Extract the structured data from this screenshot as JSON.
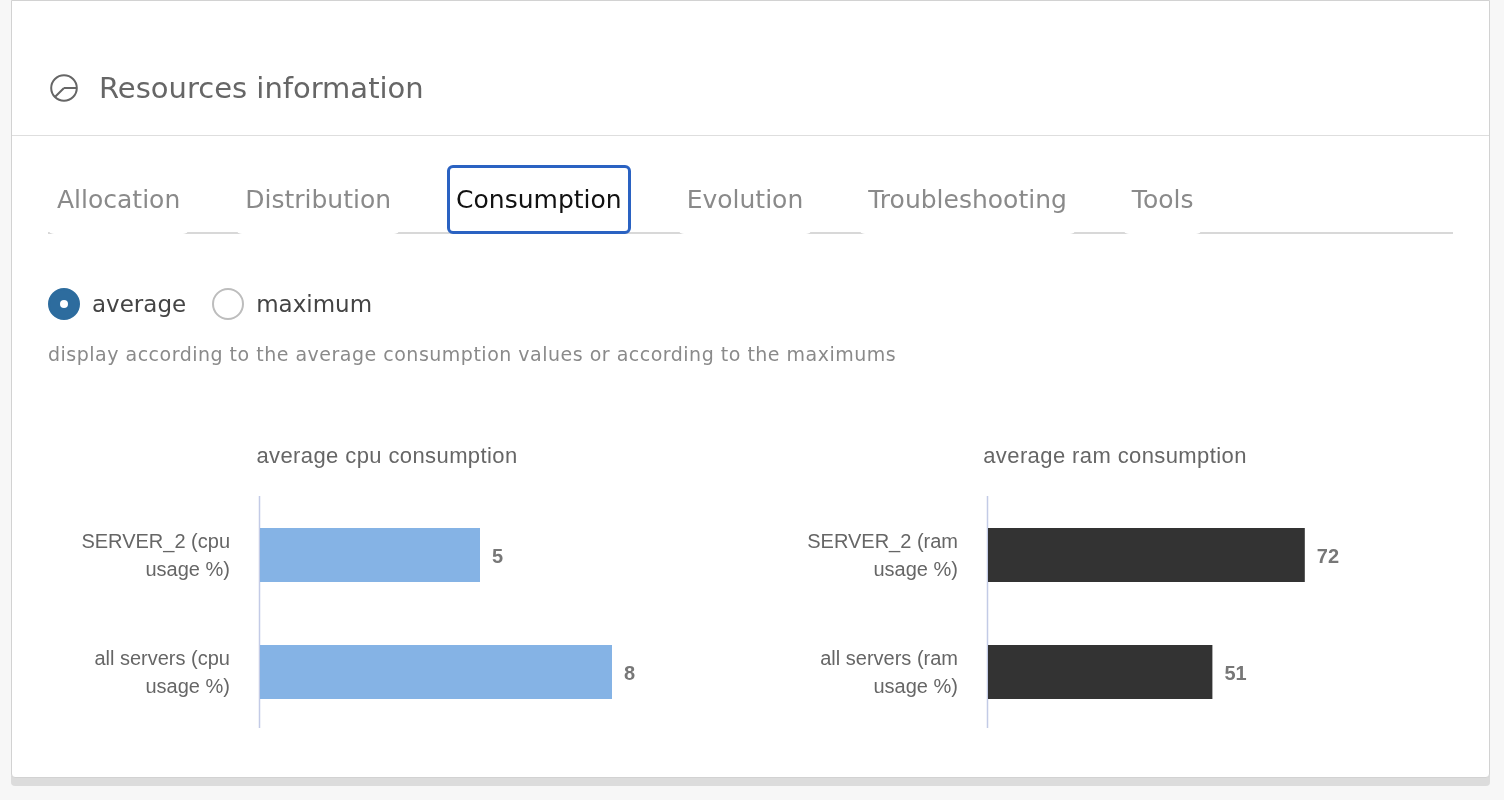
{
  "panel": {
    "title": "Resources information"
  },
  "tabs": [
    {
      "label": "Allocation",
      "selected": false
    },
    {
      "label": "Distribution",
      "selected": false
    },
    {
      "label": "Consumption",
      "selected": true
    },
    {
      "label": "Evolution",
      "selected": false
    },
    {
      "label": "Troubleshooting",
      "selected": false
    },
    {
      "label": "Tools",
      "selected": false
    }
  ],
  "display_mode": {
    "options": [
      {
        "label": "average",
        "selected": true
      },
      {
        "label": "maximum",
        "selected": false
      }
    ],
    "description": "display according to the average consumption values or according to the maximums"
  },
  "charts": [
    {
      "chart_data": {
        "type": "bar",
        "orientation": "horizontal",
        "title": "average cpu consumption",
        "categories": [
          "SERVER_2 (cpu usage %)",
          "all servers (cpu usage %)"
        ],
        "series": [
          {
            "color": "#85b3e5",
            "values": [
              5,
              8
            ]
          }
        ],
        "data_labels": true
      }
    },
    {
      "chart_data": {
        "type": "bar",
        "orientation": "horizontal",
        "title": "average ram consumption",
        "categories": [
          "SERVER_2 (ram usage %)",
          "all servers (ram usage %)"
        ],
        "series": [
          {
            "color": "#333333",
            "values": [
              72,
              51
            ]
          }
        ],
        "data_labels": true
      }
    }
  ]
}
